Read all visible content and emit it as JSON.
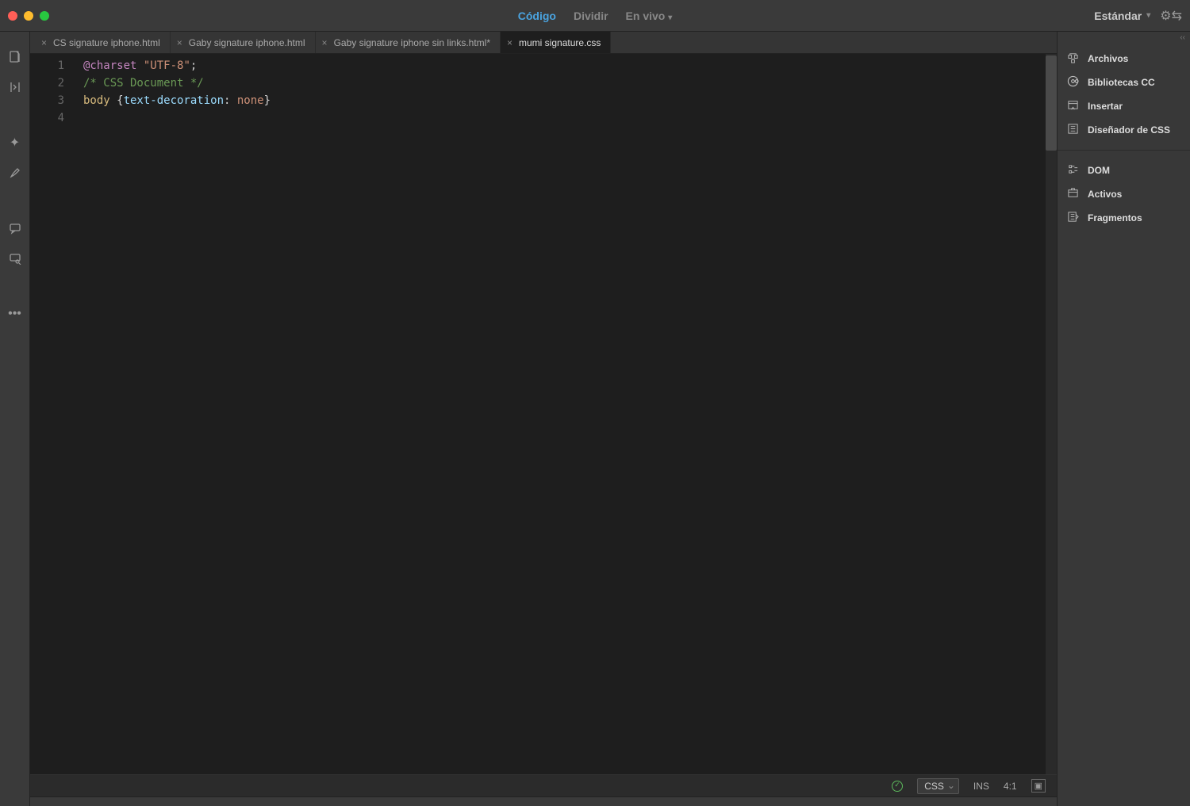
{
  "titlebar": {
    "views": {
      "code": "Código",
      "split": "Dividir",
      "live": "En vivo"
    },
    "workspace_label": "Estándar"
  },
  "file_tabs": [
    {
      "label": "CS signature iphone.html",
      "active": false
    },
    {
      "label": "Gaby signature iphone.html",
      "active": false
    },
    {
      "label": "Gaby signature iphone sin links.html*",
      "active": false
    },
    {
      "label": "mumi signature.css",
      "active": true
    }
  ],
  "code": {
    "line_numbers": [
      "1",
      "2",
      "3",
      "4"
    ],
    "l1": {
      "at": "@charset",
      "str": "\"UTF-8\"",
      "semi": ";"
    },
    "l2": {
      "comment": "/* CSS Document */"
    },
    "l3": {
      "sel": "body",
      "brace_open": " {",
      "prop": "text-decoration",
      "colon": ": ",
      "val": "none",
      "brace_close": "}"
    }
  },
  "statusbar": {
    "lang": "CSS",
    "ins": "INS",
    "pos": "4:1"
  },
  "right_panel": {
    "group1": [
      {
        "icon": "files-icon",
        "label": "Archivos"
      },
      {
        "icon": "cc-icon",
        "label": "Bibliotecas CC"
      },
      {
        "icon": "insert-icon",
        "label": "Insertar"
      },
      {
        "icon": "css-designer-icon",
        "label": "Diseñador de CSS"
      }
    ],
    "group2": [
      {
        "icon": "dom-icon",
        "label": "DOM"
      },
      {
        "icon": "assets-icon",
        "label": "Activos"
      },
      {
        "icon": "snippets-icon",
        "label": "Fragmentos"
      }
    ]
  }
}
